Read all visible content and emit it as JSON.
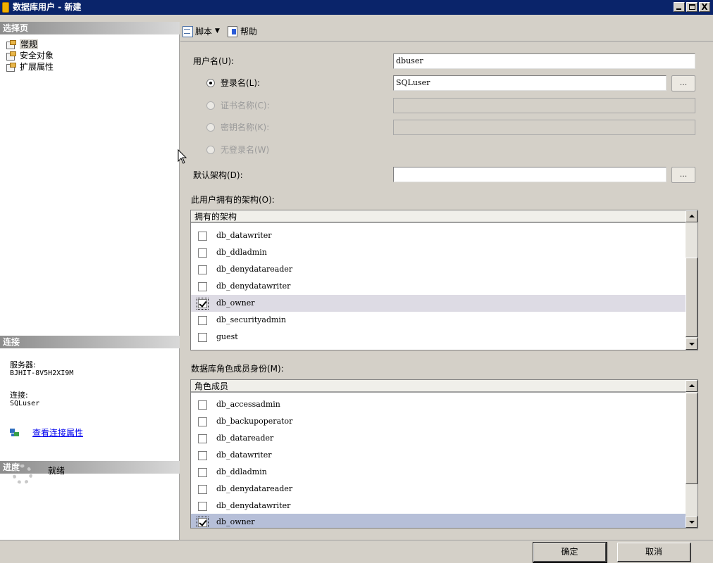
{
  "window": {
    "title": "数据库用户 - 新建",
    "caption_minimize": "_",
    "caption_maximize": "□",
    "caption_close": "X"
  },
  "left_pane": {
    "select_page_header": "选择页",
    "pages": [
      {
        "label": "常规",
        "selected": true,
        "icon": "properties-page-icon"
      },
      {
        "label": "安全对象",
        "selected": false,
        "icon": "properties-page-icon"
      },
      {
        "label": "扩展属性",
        "selected": false,
        "icon": "properties-page-icon"
      }
    ],
    "connection_header": "连接",
    "server_label": "服务器:",
    "server_value": "BJHIT-8V5H2XI9M",
    "connection_label": "连接:",
    "connection_value": "SQLuser",
    "view_connection_properties": "查看连接属性",
    "progress_header": "进度",
    "progress_status": "就绪"
  },
  "toolbar": {
    "script_label": "脚本",
    "help_label": "帮助"
  },
  "form": {
    "user_name_label": "用户名(U):",
    "user_name_value": "dbuser",
    "login_name_label": "登录名(L):",
    "login_name_value": "SQLuser",
    "certificate_name_label": "证书名称(C):",
    "key_name_label": "密钥名称(K):",
    "without_login_label": "无登录名(W)",
    "default_schema_label": "默认架构(D):",
    "default_schema_value": "",
    "browse_label": "...",
    "owned_schemas_label": "此用户拥有的架构(O):",
    "owned_schemas_header": "拥有的架构",
    "owned_schemas": [
      {
        "name": "db_datawriter",
        "checked": false
      },
      {
        "name": "db_ddladmin",
        "checked": false
      },
      {
        "name": "db_denydatareader",
        "checked": false
      },
      {
        "name": "db_denydatawriter",
        "checked": false
      },
      {
        "name": "db_owner",
        "checked": true
      },
      {
        "name": "db_securityadmin",
        "checked": false
      },
      {
        "name": "guest",
        "checked": false
      }
    ],
    "role_membership_label": "数据库角色成员身份(M):",
    "role_membership_header": "角色成员",
    "roles": [
      {
        "name": "db_accessadmin",
        "checked": false
      },
      {
        "name": "db_backupoperator",
        "checked": false
      },
      {
        "name": "db_datareader",
        "checked": false
      },
      {
        "name": "db_datawriter",
        "checked": false
      },
      {
        "name": "db_ddladmin",
        "checked": false
      },
      {
        "name": "db_denydatareader",
        "checked": false
      },
      {
        "name": "db_denydatawriter",
        "checked": false
      },
      {
        "name": "db_owner",
        "checked": true
      }
    ]
  },
  "buttons": {
    "ok_label": "确定",
    "cancel_label": "取消"
  },
  "colors": {
    "titlebar": "#0a246a",
    "window_bg": "#d4d0c8",
    "link": "#0000ee",
    "selected_row": "#b6bfd8"
  }
}
